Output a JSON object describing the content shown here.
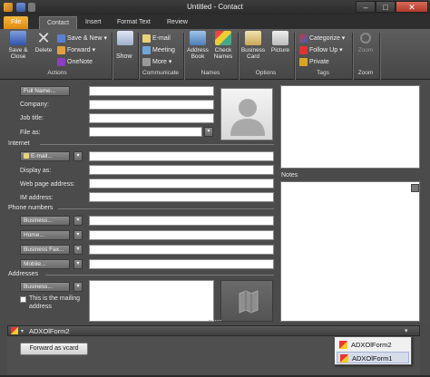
{
  "window": {
    "title": "Untitled - Contact",
    "minimize": "–",
    "maximize": "□",
    "close": "✕"
  },
  "tabs": [
    "File",
    "Contact",
    "Insert",
    "Format Text",
    "Review"
  ],
  "ribbon": {
    "actions": {
      "label": "Actions",
      "save_close": "Save &",
      "save_close_2": "Close",
      "delete": "Delete",
      "save_new": "Save & New",
      "forward": "Forward",
      "onenote": "OneNote"
    },
    "show": {
      "label": "Show"
    },
    "communicate": {
      "label": "Communicate",
      "email": "E-mail",
      "meeting": "Meeting",
      "more": "More"
    },
    "names": {
      "label": "Names",
      "address_book": "Address",
      "address_book_2": "Book",
      "check_names": "Check",
      "check_names_2": "Names"
    },
    "options": {
      "label": "Options",
      "business_card": "Business",
      "business_card_2": "Card",
      "picture": "Picture"
    },
    "tags": {
      "label": "Tags",
      "categorize": "Categorize",
      "follow_up": "Follow Up",
      "private": "Private"
    },
    "zoom": {
      "label": "Zoom",
      "zoom": "Zoom"
    }
  },
  "form": {
    "full_name": "Full Name...",
    "company": "Company:",
    "job_title": "Job title:",
    "file_as": "File as:",
    "internet": "Internet",
    "email": "E-mail...",
    "display_as": "Display as:",
    "web_page": "Web page address:",
    "im_address": "IM address:",
    "phone_numbers": "Phone numbers",
    "business": "Business...",
    "home": "Home...",
    "business_fax": "Business Fax...",
    "mobile": "Mobile...",
    "addresses": "Addresses",
    "business_addr": "Business...",
    "mailing_1": "This is the mailing",
    "mailing_2": "address",
    "notes": "Notes"
  },
  "adx": {
    "region_title": "ADXOlForm2",
    "forward_vcard": "Forward as vcard",
    "popup_items": [
      "ADXOlForm2",
      "ADXOlForm1"
    ]
  }
}
